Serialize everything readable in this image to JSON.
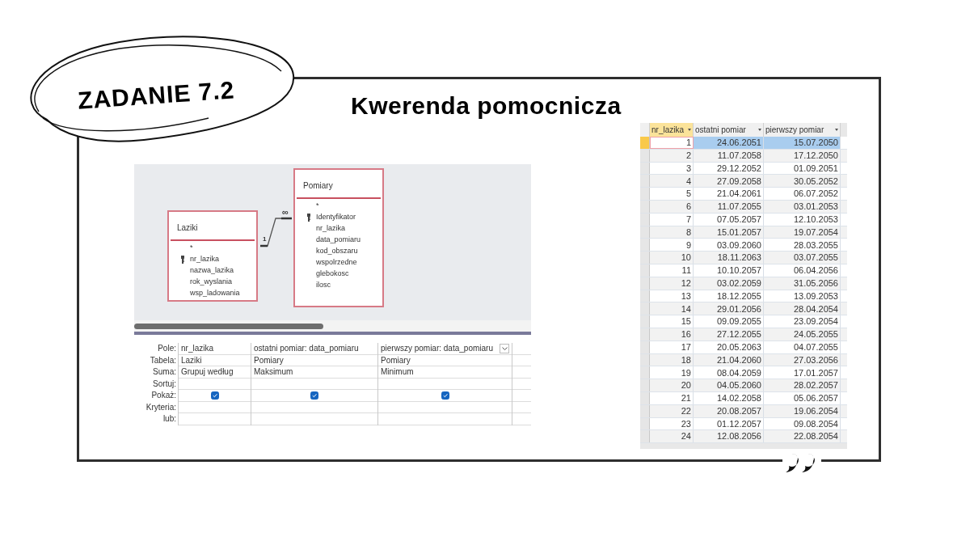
{
  "badge": {
    "title": "ZADANIE 7.2"
  },
  "heading": "Kwerenda pomocnicza",
  "design_view": {
    "tables": [
      {
        "name": "Laziki",
        "fields": [
          {
            "name": "*",
            "key": false
          },
          {
            "name": "nr_lazika",
            "key": true
          },
          {
            "name": "nazwa_lazika",
            "key": false
          },
          {
            "name": "rok_wyslania",
            "key": false
          },
          {
            "name": "wsp_ladowania",
            "key": false
          }
        ]
      },
      {
        "name": "Pomiary",
        "fields": [
          {
            "name": "*",
            "key": false
          },
          {
            "name": "Identyfikator",
            "key": true
          },
          {
            "name": "nr_lazika",
            "key": false
          },
          {
            "name": "data_pomiaru",
            "key": false
          },
          {
            "name": "kod_obszaru",
            "key": false
          },
          {
            "name": "wspolrzedne",
            "key": false
          },
          {
            "name": "glebokosc",
            "key": false
          },
          {
            "name": "ilosc",
            "key": false
          }
        ]
      }
    ],
    "relationship": {
      "one_label": "1",
      "many_label": "∞"
    },
    "grid": {
      "row_labels": [
        "Pole:",
        "Tabela:",
        "Suma:",
        "Sortuj:",
        "Pokaż:",
        "Kryteria:",
        "lub:"
      ],
      "columns": [
        {
          "field": "nr_lazika",
          "table": "Laziki",
          "total": "Grupuj według",
          "show": true,
          "focused": false
        },
        {
          "field": "ostatni pomiar: data_pomiaru",
          "table": "Pomiary",
          "total": "Maksimum",
          "show": true,
          "focused": false
        },
        {
          "field": "pierwszy pomiar: data_pomiaru",
          "table": "Pomiary",
          "total": "Minimum",
          "show": true,
          "focused": true
        }
      ]
    }
  },
  "datasheet": {
    "columns": [
      {
        "label": "nr_lazika",
        "current": true
      },
      {
        "label": "ostatni pomiar",
        "current": false
      },
      {
        "label": "pierwszy pomiar",
        "current": false
      }
    ],
    "rows": [
      {
        "values": [
          "1",
          "24.06.2051",
          "15.07.2050"
        ],
        "selected": true
      },
      {
        "values": [
          "2",
          "11.07.2058",
          "17.12.2050"
        ],
        "selected": false
      },
      {
        "values": [
          "3",
          "29.12.2052",
          "01.09.2051"
        ],
        "selected": false
      },
      {
        "values": [
          "4",
          "27.09.2058",
          "30.05.2052"
        ],
        "selected": false
      },
      {
        "values": [
          "5",
          "21.04.2061",
          "06.07.2052"
        ],
        "selected": false
      },
      {
        "values": [
          "6",
          "11.07.2055",
          "03.01.2053"
        ],
        "selected": false
      },
      {
        "values": [
          "7",
          "07.05.2057",
          "12.10.2053"
        ],
        "selected": false
      },
      {
        "values": [
          "8",
          "15.01.2057",
          "19.07.2054"
        ],
        "selected": false
      },
      {
        "values": [
          "9",
          "03.09.2060",
          "28.03.2055"
        ],
        "selected": false
      },
      {
        "values": [
          "10",
          "18.11.2063",
          "03.07.2055"
        ],
        "selected": false
      },
      {
        "values": [
          "11",
          "10.10.2057",
          "06.04.2056"
        ],
        "selected": false
      },
      {
        "values": [
          "12",
          "03.02.2059",
          "31.05.2056"
        ],
        "selected": false
      },
      {
        "values": [
          "13",
          "18.12.2055",
          "13.09.2053"
        ],
        "selected": false
      },
      {
        "values": [
          "14",
          "29.01.2056",
          "28.04.2054"
        ],
        "selected": false
      },
      {
        "values": [
          "15",
          "09.09.2055",
          "23.09.2054"
        ],
        "selected": false
      },
      {
        "values": [
          "16",
          "27.12.2055",
          "24.05.2055"
        ],
        "selected": false
      },
      {
        "values": [
          "17",
          "20.05.2063",
          "04.07.2055"
        ],
        "selected": false
      },
      {
        "values": [
          "18",
          "21.04.2060",
          "27.03.2056"
        ],
        "selected": false
      },
      {
        "values": [
          "19",
          "08.04.2059",
          "17.01.2057"
        ],
        "selected": false
      },
      {
        "values": [
          "20",
          "04.05.2060",
          "28.02.2057"
        ],
        "selected": false
      },
      {
        "values": [
          "21",
          "14.02.2058",
          "05.06.2057"
        ],
        "selected": false
      },
      {
        "values": [
          "22",
          "20.08.2057",
          "19.06.2054"
        ],
        "selected": false
      },
      {
        "values": [
          "23",
          "01.12.2057",
          "09.08.2054"
        ],
        "selected": false
      },
      {
        "values": [
          "24",
          "12.08.2056",
          "22.08.2054"
        ],
        "selected": false
      }
    ]
  }
}
